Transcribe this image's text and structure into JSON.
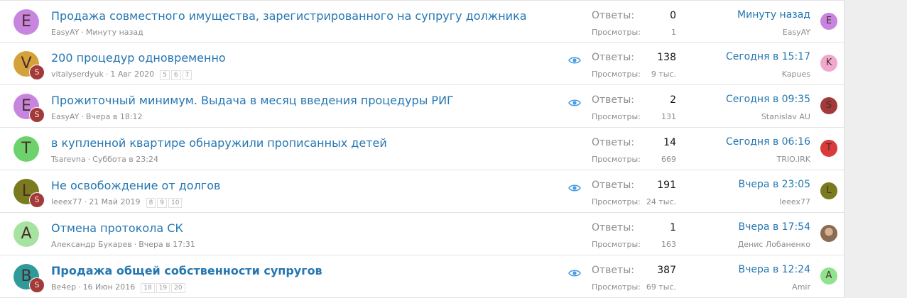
{
  "threads": [
    {
      "avatar_letter": "E",
      "avatar_color": "#c885e0",
      "has_badge": false,
      "title": "Продажа совместного имущества, зарегистрированного на супругу должника",
      "bold": false,
      "author": "EasyAY",
      "date": "Минуту назад",
      "pages": [],
      "watched": false,
      "replies_label": "Ответы:",
      "replies": "0",
      "views_label": "Просмотры:",
      "views": "1",
      "last_time": "Минуту назад",
      "last_user": "EasyAY",
      "last_avatar_letter": "E",
      "last_avatar_color": "#c885e0"
    },
    {
      "avatar_letter": "V",
      "avatar_color": "#d4a23a",
      "has_badge": true,
      "badge_letter": "S",
      "title": "200 процедур одновременно",
      "bold": false,
      "author": "vitalyserdyuk",
      "date": "1 Авг 2020",
      "pages": [
        "5",
        "6",
        "7"
      ],
      "watched": true,
      "replies_label": "Ответы:",
      "replies": "138",
      "views_label": "Просмотры:",
      "views": "9 тыс.",
      "last_time": "Сегодня в 15:17",
      "last_user": "Kapues",
      "last_avatar_letter": "K",
      "last_avatar_color": "#f0a8cc"
    },
    {
      "avatar_letter": "E",
      "avatar_color": "#c885e0",
      "has_badge": true,
      "badge_letter": "S",
      "title": "Прожиточный минимум. Выдача в месяц введения процедуры РИГ",
      "bold": false,
      "author": "EasyAY",
      "date": "Вчера в 18:12",
      "pages": [],
      "watched": true,
      "replies_label": "Ответы:",
      "replies": "2",
      "views_label": "Просмотры:",
      "views": "131",
      "last_time": "Сегодня в 09:35",
      "last_user": "Stanislav AU",
      "last_avatar_letter": "S",
      "last_avatar_color": "#a33a3a"
    },
    {
      "avatar_letter": "T",
      "avatar_color": "#6cd36c",
      "has_badge": false,
      "title": "в купленной квартире обнаружили прописанных детей",
      "bold": false,
      "author": "Tsarevna",
      "date": "Суббота в 23:24",
      "pages": [],
      "watched": false,
      "replies_label": "Ответы:",
      "replies": "14",
      "views_label": "Просмотры:",
      "views": "669",
      "last_time": "Сегодня в 06:16",
      "last_user": "TRIO.IRK",
      "last_avatar_letter": "T",
      "last_avatar_color": "#d93a3a"
    },
    {
      "avatar_letter": "L",
      "avatar_color": "#7a7a1e",
      "has_badge": true,
      "badge_letter": "S",
      "title": "Не освобождение от долгов",
      "bold": false,
      "author": "leeex77",
      "date": "21 Май 2019",
      "pages": [
        "8",
        "9",
        "10"
      ],
      "watched": true,
      "replies_label": "Ответы:",
      "replies": "191",
      "views_label": "Просмотры:",
      "views": "24 тыс.",
      "last_time": "Вчера в 23:05",
      "last_user": "leeex77",
      "last_avatar_letter": "L",
      "last_avatar_color": "#7a7a1e"
    },
    {
      "avatar_letter": "A",
      "avatar_color": "#a6e3a0",
      "has_badge": false,
      "title": "Отмена протокола СК",
      "bold": false,
      "author": "Александр Букарев",
      "date": "Вчера в 17:31",
      "pages": [],
      "watched": false,
      "replies_label": "Ответы:",
      "replies": "1",
      "views_label": "Просмотры:",
      "views": "163",
      "last_time": "Вчера в 17:54",
      "last_user": "Денис Лобаненко",
      "last_avatar_letter": "",
      "last_avatar_color": "#9a7a60"
    },
    {
      "avatar_letter": "B",
      "avatar_color": "#2f9a9a",
      "has_badge": true,
      "badge_letter": "S",
      "title": "Продажа общей собственности супругов",
      "bold": true,
      "author": "Be4ep",
      "date": "16 Июн 2016",
      "pages": [
        "18",
        "19",
        "20"
      ],
      "watched": true,
      "replies_label": "Ответы:",
      "replies": "387",
      "views_label": "Просмотры:",
      "views": "69 тыс.",
      "last_time": "Вчера в 12:24",
      "last_user": "Amir",
      "last_avatar_letter": "A",
      "last_avatar_color": "#8fe38f"
    }
  ]
}
